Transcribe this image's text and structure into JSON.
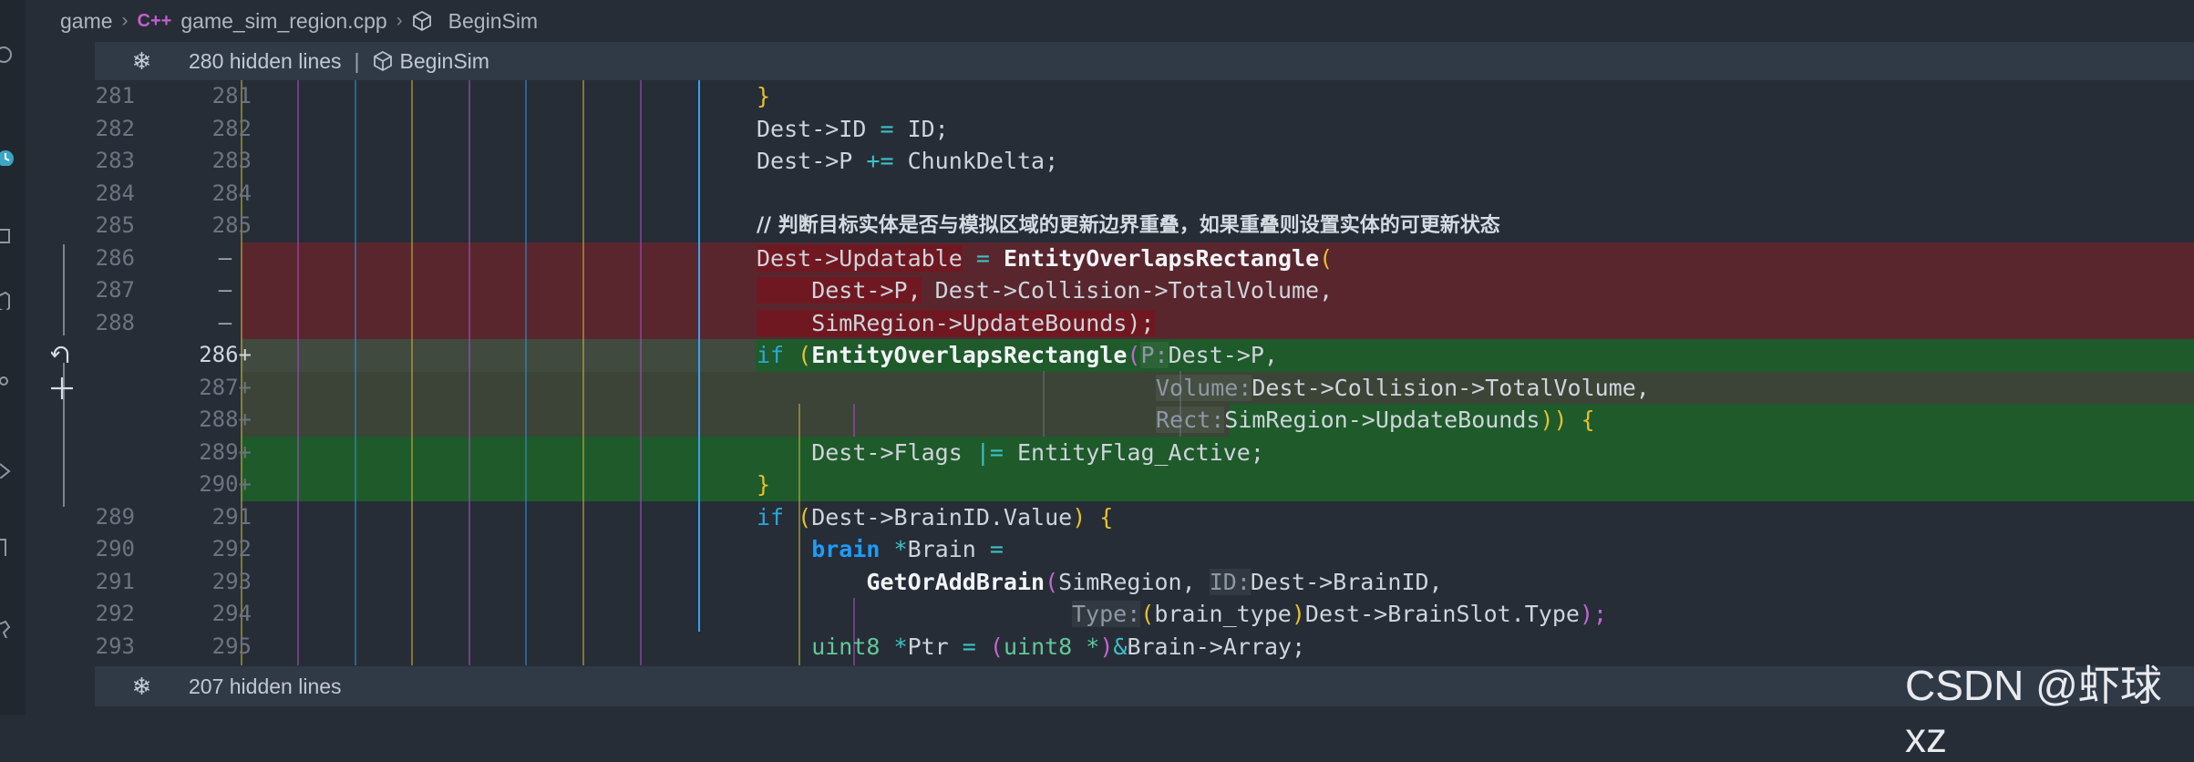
{
  "breadcrumb": {
    "folder": "game",
    "file_icon": "C++",
    "file": "game_sim_region.cpp",
    "symbol": "BeginSim"
  },
  "fold_top": {
    "text": "280 hidden lines",
    "separator": "|",
    "symbol": "BeginSim"
  },
  "fold_bottom": {
    "text": "207 hidden lines"
  },
  "lines": {
    "l1": {
      "old": "281",
      "new": "281"
    },
    "l2": {
      "old": "282",
      "new": "282"
    },
    "l3": {
      "old": "283",
      "new": "283"
    },
    "l4": {
      "old": "284",
      "new": "284"
    },
    "l5": {
      "old": "285",
      "new": "285"
    },
    "l6": {
      "old": "286",
      "new": "",
      "sign": "—"
    },
    "l7": {
      "old": "287",
      "new": "",
      "sign": "—"
    },
    "l8": {
      "old": "288",
      "new": "",
      "sign": "—"
    },
    "l9": {
      "old": "",
      "new": "286+"
    },
    "l10": {
      "old": "",
      "new": "287+"
    },
    "l11": {
      "old": "",
      "new": "288+"
    },
    "l12": {
      "old": "",
      "new": "289+"
    },
    "l13": {
      "old": "",
      "new": "290+"
    },
    "l14": {
      "old": "289",
      "new": "291"
    },
    "l15": {
      "old": "290",
      "new": "292"
    },
    "l16": {
      "old": "291",
      "new": "293"
    },
    "l17": {
      "old": "292",
      "new": "294"
    },
    "l18": {
      "old": "293",
      "new": "295"
    }
  },
  "code": {
    "c1": {
      "brace": "}"
    },
    "c2": {
      "a": "Dest->ID ",
      "op": "=",
      "b": " ID;"
    },
    "c3": {
      "a": "Dest->P ",
      "op": "+=",
      "b": " ChunkDelta;"
    },
    "c5": {
      "comment": "// 判断目标实体是否与模拟区域的更新边界重叠，如果重叠则设置实体的可更新状态"
    },
    "c6": {
      "a": "Dest->Updatable",
      "op": " = ",
      "fn": "EntityOverlapsRectangle",
      "paren": "("
    },
    "c7": {
      "a": "    Dest->P,",
      "b": " Dest->Collision->TotalVolume,"
    },
    "c8": {
      "a": "    SimRegion->UpdateBounds);"
    },
    "c9": {
      "kw": "if",
      "sp": " (",
      "fn": "EntityOverlapsRectangle",
      "paren": "(",
      "hint": "P:",
      "arg": "Dest->P,"
    },
    "c10": {
      "hint": "Volume:",
      "arg": "Dest->Collision->TotalVolume,"
    },
    "c11": {
      "hint": "Rect:",
      "arg": "SimRegion->UpdateBounds",
      "close": ")) {"
    },
    "c12": {
      "a": "    Dest->Flags ",
      "op": "|=",
      "b": " EntityFlag_Active;"
    },
    "c13": {
      "brace": "}"
    },
    "c14": {
      "kw": "if",
      "paren": " (",
      "a": "Dest->BrainID.Value",
      "close": ") {"
    },
    "c15": {
      "type": "    brain",
      "op": " *",
      "a": "Brain ",
      "eq": "="
    },
    "c16": {
      "fn": "        GetOrAddBrain",
      "paren": "(",
      "a": "SimRegion, ",
      "hint": "ID:",
      "b": "Dest->BrainID,"
    },
    "c17": {
      "hint": "Type:",
      "paren": "(",
      "a": "brain_type",
      "paren2": ")",
      "b": "Dest->BrainSlot.Type",
      "close": ");"
    },
    "c18": {
      "type": "    uint8",
      "op": " *",
      "a": "Ptr ",
      "eq": "= ",
      "paren": "(",
      "type2": "uint8 *",
      "paren2": ")",
      "amp": "&",
      "b": "Brain->Array;"
    }
  },
  "watermark": "CSDN @虾球xz"
}
